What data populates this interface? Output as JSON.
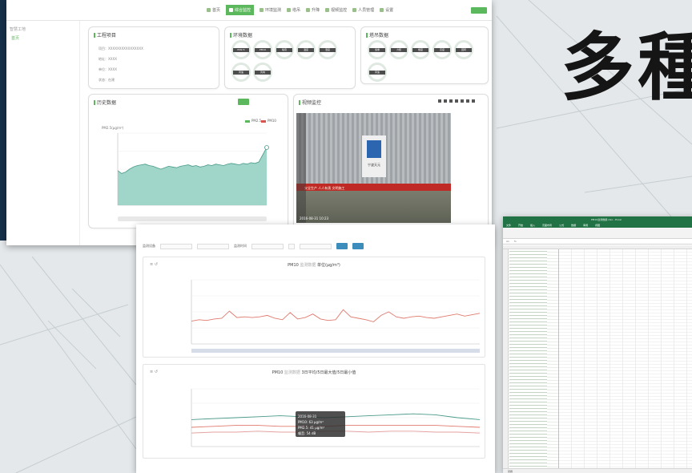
{
  "headline": "多種",
  "dashboard": {
    "sidebar": {
      "title": "智慧工地",
      "active_item": "首页"
    },
    "nav": [
      {
        "label": "首页",
        "active": false
      },
      {
        "label": "综合监控",
        "active": true
      },
      {
        "label": "环境监测",
        "active": false
      },
      {
        "label": "塔吊",
        "active": false
      },
      {
        "label": "升降",
        "active": false
      },
      {
        "label": "视频监控",
        "active": false
      },
      {
        "label": "人员管理",
        "active": false
      },
      {
        "label": "设置",
        "active": false
      }
    ],
    "project_panel": {
      "title": "工程项目",
      "rows": [
        "项目：XXXXXXXXXXXXXXXX",
        "地址：XXXX",
        "单位：XXXX",
        "状态：在建"
      ]
    },
    "env_panel": {
      "title": "环境数据",
      "gauges": [
        "PM2.5",
        "PM10",
        "噪音",
        "温度",
        "湿度",
        "风速",
        "风向"
      ]
    },
    "crane_panel": {
      "title": "塔吊数据",
      "gauges": [
        "载重",
        "力矩",
        "幅度",
        "高度",
        "回转",
        "风速"
      ]
    },
    "history_panel": {
      "title": "历史数据",
      "legend": [
        "PM2.5",
        "PM10"
      ],
      "y_label": "PM2.5(μg/m³)"
    },
    "video_panel": {
      "title": "视频监控",
      "sign_text": "宁波天元",
      "banner_text": "安全生产 人人有责 文明施工",
      "osd_text": "2016-08-31 10:23"
    }
  },
  "monitor": {
    "nav": [
      "首页",
      "综合监控",
      "环境监测",
      "塔吊",
      "升降",
      "视频监控",
      "人员管理",
      "设置"
    ],
    "filter": {
      "device_label": "监测设备",
      "time_label": "监测时间",
      "btn1": "查询",
      "btn2": "导出"
    },
    "chart1": {
      "title": "PM10",
      "subtitle": "监测数据",
      "unit": "单位(μg/m³)"
    },
    "chart2": {
      "title": "PM10",
      "subtitle": "监测数据",
      "unit": "3日平均/5日最大值/5日最小值"
    },
    "tooltip": [
      "2016-08-31",
      "PM10: 63 μg/m³",
      "PM2.5: 41 μg/m³",
      "噪音: 54 dB"
    ]
  },
  "spreadsheet": {
    "title": "PM10监测数据.xlsx - Excel",
    "menu": [
      "文件",
      "开始",
      "插入",
      "页面布局",
      "公式",
      "数据",
      "审阅",
      "视图"
    ],
    "cell_ref": "A1",
    "status": "就绪"
  },
  "colors": {
    "accent_green": "#5cb85c",
    "series_red": "#e07a6e",
    "series_teal": "#4a9a8a",
    "excel_green": "#217346",
    "navy": "#16304a"
  },
  "chart_data": [
    {
      "type": "area",
      "title": "历史数据",
      "ylabel": "PM2.5(μg/m³)",
      "ylim": [
        0,
        100
      ],
      "values": [
        48,
        44,
        46,
        50,
        53,
        55,
        56,
        57,
        55,
        54,
        52,
        50,
        52,
        54,
        53,
        52,
        54,
        55,
        56,
        54,
        55,
        53,
        54,
        56,
        55,
        57,
        56,
        55,
        57,
        58,
        57,
        56,
        58,
        57,
        59,
        58,
        60,
        70,
        80
      ]
    },
    {
      "type": "line",
      "title": "PM10",
      "ylim": [
        0,
        90
      ],
      "series": [
        {
          "values": [
            32,
            34,
            33,
            35,
            36,
            46,
            37,
            38,
            37,
            38,
            40,
            36,
            34,
            44,
            35,
            37,
            42,
            35,
            33,
            34,
            48,
            38,
            36,
            34,
            31,
            40,
            45,
            38,
            36,
            38,
            39,
            37,
            36,
            38,
            40,
            42,
            39,
            41,
            43
          ]
        }
      ]
    },
    {
      "type": "line",
      "title": "PM10",
      "ylim": [
        0,
        60
      ],
      "series": [
        {
          "values": [
            28,
            29,
            30,
            31,
            32,
            31,
            30,
            31,
            32,
            33,
            34,
            33,
            30,
            28
          ]
        },
        {
          "values": [
            20,
            21,
            22,
            22,
            21,
            21,
            21,
            22,
            22,
            22,
            22,
            22,
            21,
            20
          ]
        },
        {
          "values": [
            14,
            15,
            15,
            16,
            15,
            15,
            16,
            16,
            15,
            16,
            16,
            15,
            15,
            14
          ]
        }
      ]
    }
  ]
}
